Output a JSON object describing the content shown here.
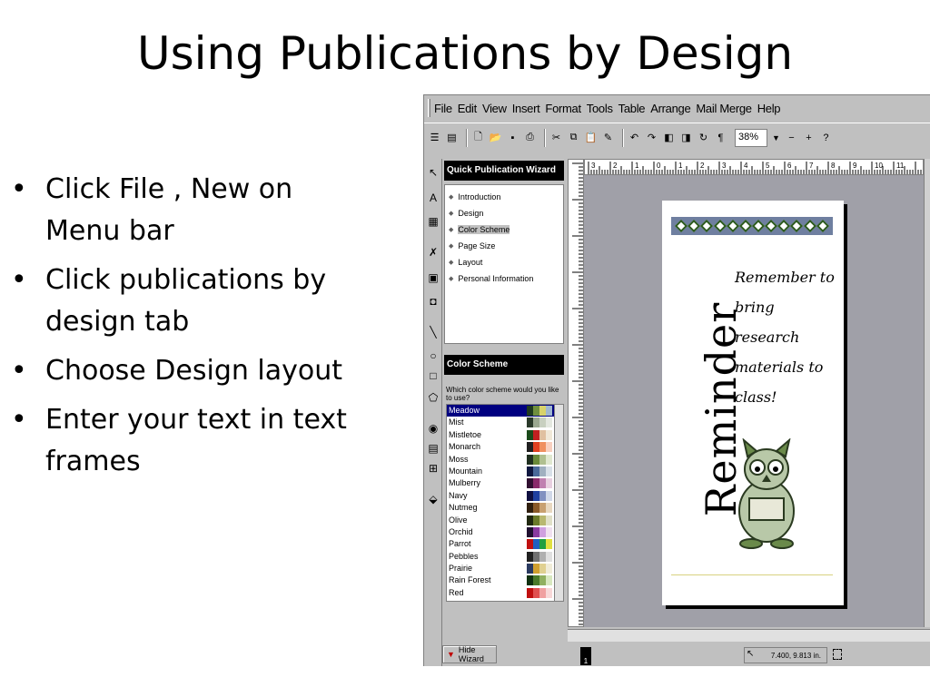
{
  "slide": {
    "title": "Using Publications by Design",
    "bullets": [
      "Click File , New on Menu bar",
      "Click publications by design tab",
      "Choose Design layout",
      "Enter your text in text frames"
    ]
  },
  "app": {
    "menu": [
      "File",
      "Edit",
      "View",
      "Insert",
      "Format",
      "Tools",
      "Table",
      "Arrange",
      "Mail Merge",
      "Help"
    ],
    "zoom": "38%",
    "wizard": {
      "title": "Quick Publication Wizard",
      "steps": [
        "Introduction",
        "Design",
        "Color Scheme",
        "Page Size",
        "Layout",
        "Personal Information"
      ],
      "selected_step": "Color Scheme",
      "section_title": "Color Scheme",
      "question": "Which color scheme would you like to use?",
      "schemes": [
        "Meadow",
        "Mist",
        "Mistletoe",
        "Monarch",
        "Moss",
        "Mountain",
        "Mulberry",
        "Navy",
        "Nutmeg",
        "Olive",
        "Orchid",
        "Parrot",
        "Pebbles",
        "Prairie",
        "Rain Forest",
        "Red"
      ],
      "selected_scheme": "Meadow",
      "hide_label": "Hide Wizard"
    },
    "ruler_numbers": [
      "3",
      "2",
      "1",
      "0",
      "1",
      "2",
      "3",
      "4",
      "5",
      "6",
      "7",
      "8",
      "9",
      "10",
      "11"
    ],
    "document": {
      "heading": "Reminder",
      "note": "Remember to bring research materials to class!"
    },
    "status": {
      "page_number": "1",
      "coordinates": "7.400, 9.813 in."
    }
  }
}
